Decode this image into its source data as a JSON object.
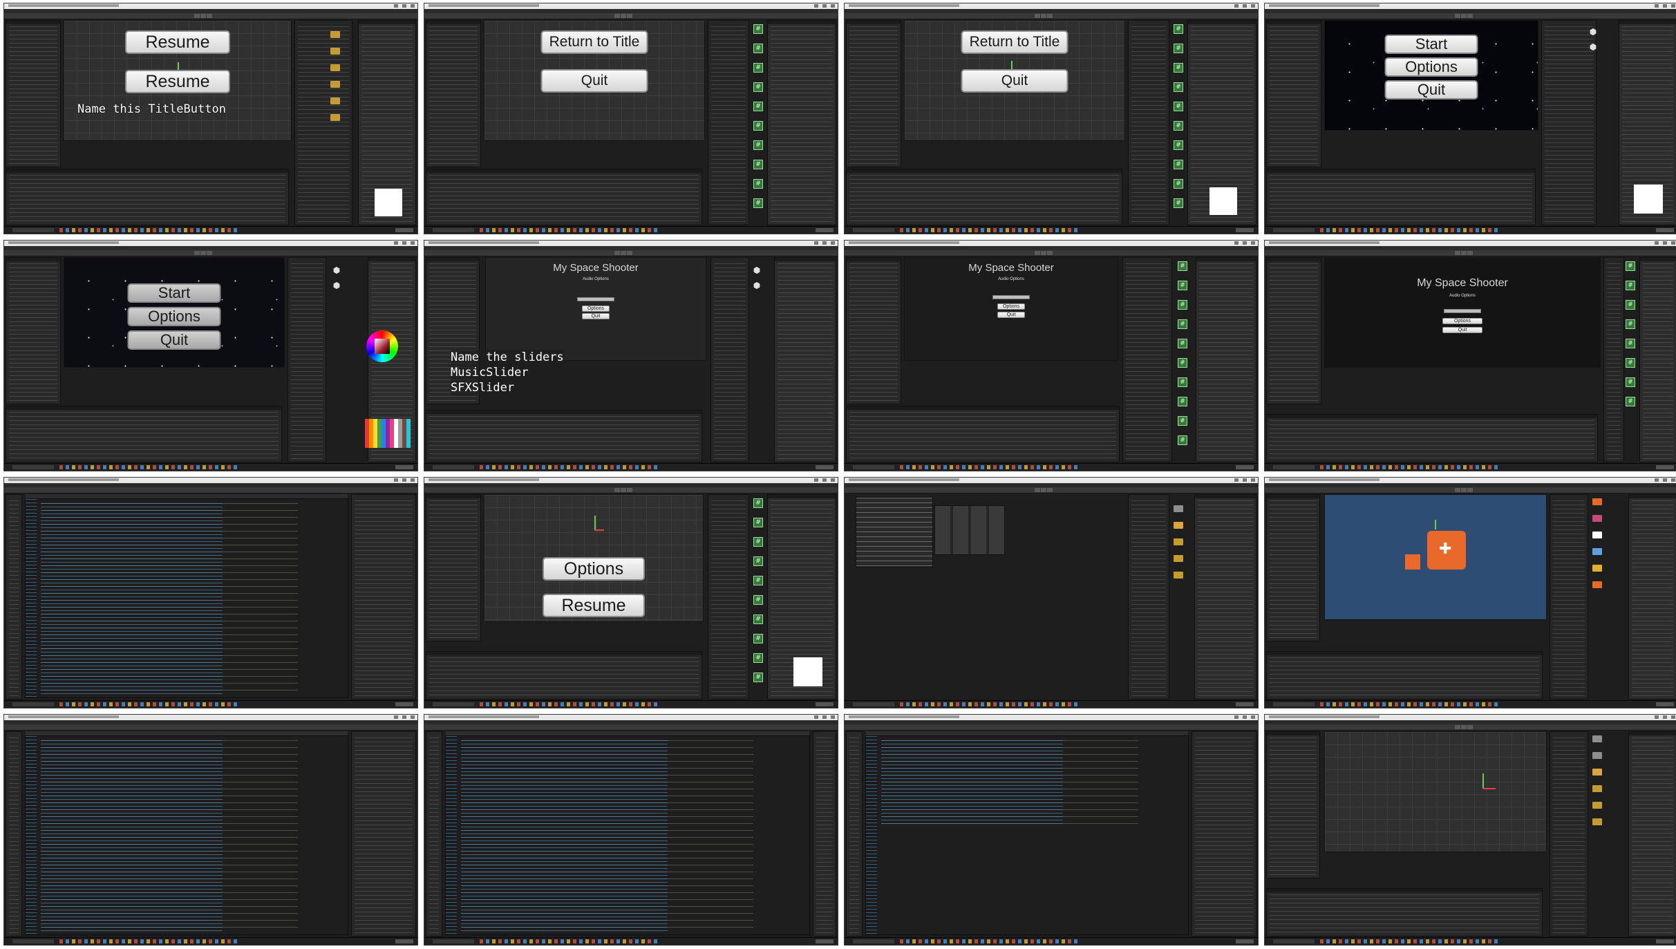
{
  "tiles": [
    {
      "id": 1,
      "buttons": [
        "Resume",
        "Resume"
      ],
      "caption": "Name this TitleButton"
    },
    {
      "id": 2,
      "buttons": [
        "Return to Title",
        "Quit"
      ]
    },
    {
      "id": 3,
      "buttons": [
        "Return to Title",
        "Quit"
      ]
    },
    {
      "id": 4,
      "buttons": [
        "Start",
        "Options",
        "Quit"
      ]
    },
    {
      "id": 5,
      "buttons": [
        "Start",
        "Options",
        "Quit"
      ]
    },
    {
      "id": 6,
      "title": "My Space Shooter",
      "subtitle": "Audio Options",
      "caption": "Name the sliders\nMusicSlider\nSFXSlider"
    },
    {
      "id": 7,
      "title": "My Space Shooter",
      "subtitle": "Audio Options"
    },
    {
      "id": 8,
      "title": "My Space Shooter",
      "subtitle": "Audio Options"
    },
    {
      "id": 9,
      "kind": "code-editor"
    },
    {
      "id": 10,
      "buttons": [
        "Options",
        "Resume"
      ]
    },
    {
      "id": 11,
      "kind": "audio-mixer"
    },
    {
      "id": 12,
      "kind": "sprite-scene"
    },
    {
      "id": 13,
      "kind": "code-editor"
    },
    {
      "id": 14,
      "kind": "code-editor"
    },
    {
      "id": 15,
      "kind": "code-editor"
    },
    {
      "id": 16,
      "kind": "scene-gizmo"
    }
  ],
  "icons": {
    "script_icon": "#",
    "unity_icon": "⬢"
  },
  "colors": {
    "editor_bg": "#1e1e1e",
    "panel_bg": "#282828",
    "scene_grid": "#303030",
    "space_bg": "#05060b",
    "sprite_orange": "#e8692a",
    "scene_blue": "#2d4d74"
  }
}
